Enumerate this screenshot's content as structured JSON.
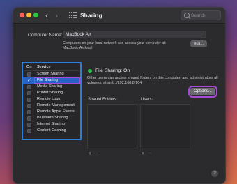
{
  "window": {
    "title": "Sharing",
    "search_placeholder": "Search",
    "nav": {
      "back_glyph": "‹",
      "forward_glyph": "›"
    }
  },
  "computer_name": {
    "label": "Computer Name:",
    "value": "MacBook Air",
    "note": "Computers on your local network can access your computer at: MacBook-Air.local",
    "edit_label": "Edit..."
  },
  "services": {
    "header_on": "On",
    "header_service": "Service",
    "items": [
      {
        "label": "Screen Sharing",
        "checked": false,
        "selected": false
      },
      {
        "label": "File Sharing",
        "checked": true,
        "selected": true
      },
      {
        "label": "Media Sharing",
        "checked": false,
        "selected": false
      },
      {
        "label": "Printer Sharing",
        "checked": false,
        "selected": false
      },
      {
        "label": "Remote Login",
        "checked": false,
        "selected": false
      },
      {
        "label": "Remote Management",
        "checked": false,
        "selected": false
      },
      {
        "label": "Remote Apple Events",
        "checked": false,
        "selected": false
      },
      {
        "label": "Bluetooth Sharing",
        "checked": false,
        "selected": false
      },
      {
        "label": "Internet Sharing",
        "checked": false,
        "selected": false
      },
      {
        "label": "Content Caching",
        "checked": false,
        "selected": false
      }
    ]
  },
  "detail": {
    "status": "File Sharing: On",
    "description": "Other users can access shared folders on this computer, and administrators all volumes, at smb://192.168.8.104",
    "options_label": "Options...",
    "shared_folders_title": "Shared Folders:",
    "users_title": "Users:",
    "add_glyph": "+",
    "remove_glyph": "−",
    "help_glyph": "?"
  },
  "colors": {
    "accent_blue": "#2763c6",
    "highlight_purple": "#a84ad8",
    "status_green": "#2ac34a"
  }
}
